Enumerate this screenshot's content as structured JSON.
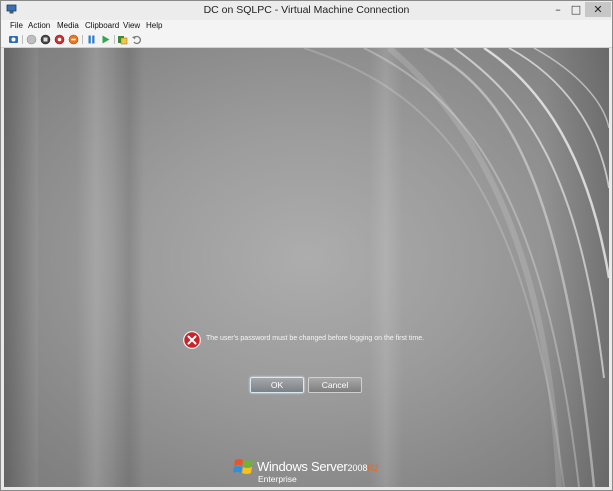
{
  "window": {
    "title": "DC on SQLPC - Virtual Machine Connection",
    "controls": {
      "minimize": "–",
      "maximize": "□",
      "close": "✕"
    }
  },
  "menu": {
    "items": [
      {
        "label": "File"
      },
      {
        "label": "Action"
      },
      {
        "label": "Media"
      },
      {
        "label": "Clipboard"
      },
      {
        "label": "View"
      },
      {
        "label": "Help"
      }
    ]
  },
  "toolbar": {
    "icons": [
      "ctrl-alt-del-icon",
      "start-icon",
      "turn-off-icon",
      "shut-down-icon",
      "save-state-icon",
      "pause-icon",
      "resume-icon",
      "snapshot-icon",
      "revert-icon"
    ]
  },
  "dialog": {
    "message": "The user's password must be changed before logging on the first time.",
    "ok_label": "OK",
    "cancel_label": "Cancel",
    "icon": "error-icon"
  },
  "branding": {
    "product": "Windows Server",
    "version": "2008",
    "release": "R2",
    "edition": "Enterprise"
  },
  "colors": {
    "error_red": "#c8242b",
    "r2_orange": "#e06b2a"
  }
}
